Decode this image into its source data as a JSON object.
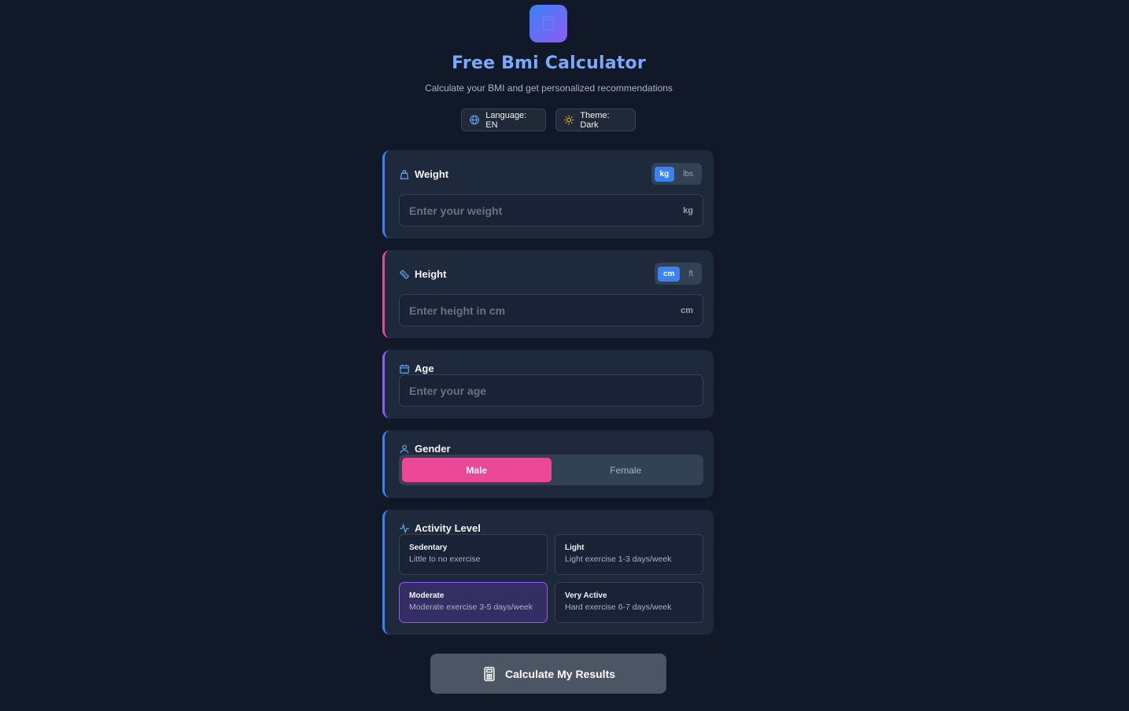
{
  "header": {
    "title": "Free Bmi Calculator",
    "subtitle": "Calculate your BMI and get personalized recommendations",
    "logo_icon": "calculator-icon"
  },
  "toolbar": {
    "language_label": "Language: EN",
    "theme_label": "Theme: Dark"
  },
  "colors": {
    "accent_blue": "#3b82f6",
    "accent_pink": "#ec4899",
    "accent_purple": "#8b5cf6",
    "background": "#111827",
    "card": "#1e293b"
  },
  "weight": {
    "label": "Weight",
    "units": [
      "kg",
      "lbs"
    ],
    "selected_unit": "kg",
    "placeholder": "Enter your weight",
    "value": "",
    "suffix": "kg"
  },
  "height": {
    "label": "Height",
    "units": [
      "cm",
      "ft"
    ],
    "selected_unit": "cm",
    "placeholder": "Enter height in cm",
    "value": "",
    "suffix": "cm"
  },
  "age": {
    "label": "Age",
    "placeholder": "Enter your age",
    "value": ""
  },
  "gender": {
    "label": "Gender",
    "options": [
      "Male",
      "Female"
    ],
    "selected": "Male"
  },
  "activity": {
    "label": "Activity Level",
    "options": [
      {
        "title": "Sedentary",
        "desc": "Little to no exercise"
      },
      {
        "title": "Light",
        "desc": "Light exercise 1-3 days/week"
      },
      {
        "title": "Moderate",
        "desc": "Moderate exercise 3-5 days/week"
      },
      {
        "title": "Very Active",
        "desc": "Hard exercise 6-7 days/week"
      }
    ],
    "selected": "Moderate"
  },
  "actions": {
    "calculate_label": "Calculate My Results"
  }
}
